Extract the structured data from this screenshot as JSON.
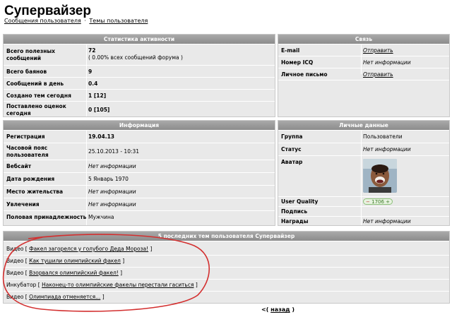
{
  "page": {
    "title": "Супервайзер",
    "breadcrumb": {
      "link1": "Сообщения пользователя",
      "separator": "·",
      "link2": "Темы пользователя"
    }
  },
  "activity": {
    "header": "Статистика активности",
    "rows": [
      {
        "label": "Всего полезных сообщений",
        "value": "72",
        "sub": "( 0.00% всех сообщений форума )"
      },
      {
        "label": "Всего баянов",
        "value": "9"
      },
      {
        "label": "Сообщений в день",
        "value": "0.4"
      },
      {
        "label": "Создано тем сегодня",
        "value": "1 [12]"
      },
      {
        "label": "Поставлено оценок сегодня",
        "value": "0 [105]"
      }
    ]
  },
  "contact": {
    "header": "Связь",
    "rows": [
      {
        "label": "E-mail",
        "value": "Отправить"
      },
      {
        "label": "Номер ICQ",
        "value": "Нет информации"
      },
      {
        "label": "Личное письмо",
        "value": "Отправить"
      }
    ]
  },
  "info": {
    "header": "Информация",
    "rows": [
      {
        "label": "Регистрация",
        "value": "19.04.13"
      },
      {
        "label": "Часовой пояс пользователя",
        "value": "25.10.2013 - 10:31"
      },
      {
        "label": "Вебсайт",
        "value": "Нет информации"
      },
      {
        "label": "Дата рождения",
        "value": "5 Январь 1970"
      },
      {
        "label": "Место жительства",
        "value": "Нет информации"
      },
      {
        "label": "Увлечения",
        "value": "Нет информации"
      },
      {
        "label": "Половая принадлежность",
        "value": "Мужчина"
      }
    ]
  },
  "personal": {
    "header": "Личные данные",
    "rows": [
      {
        "label": "Группа",
        "value": "Пользователи"
      },
      {
        "label": "Статус",
        "value": "Нет информации"
      },
      {
        "label": "Аватар",
        "value": ""
      },
      {
        "label": "User Quality",
        "value": "1706"
      },
      {
        "label": "Подпись",
        "value": ""
      },
      {
        "label": "Награды",
        "value": "Нет информации"
      }
    ]
  },
  "topics": {
    "header": "5 последних тем пользователя Супервайзер",
    "items": [
      {
        "section": "Видео",
        "title": "Факел загорелся у голубого Деда Мороза!"
      },
      {
        "section": "Видео",
        "title": "Как тушили олимпийский факел"
      },
      {
        "section": "Видео",
        "title": "Взорвался олимпийский факел!"
      },
      {
        "section": "Инкубатор",
        "title": "Наконец-то олимпийские факелы перестали гаситься"
      },
      {
        "section": "Видео",
        "title": "Олимпиада отменяется..."
      }
    ]
  },
  "back": {
    "prefix": "<",
    "open": "(",
    "label": "назад",
    "close": ")"
  },
  "colors": {
    "panel_bg": "#e9e9e9",
    "header_bg": "#9a9a9a",
    "annotation": "#d32f2f",
    "badge_green": "#3b7a24"
  }
}
